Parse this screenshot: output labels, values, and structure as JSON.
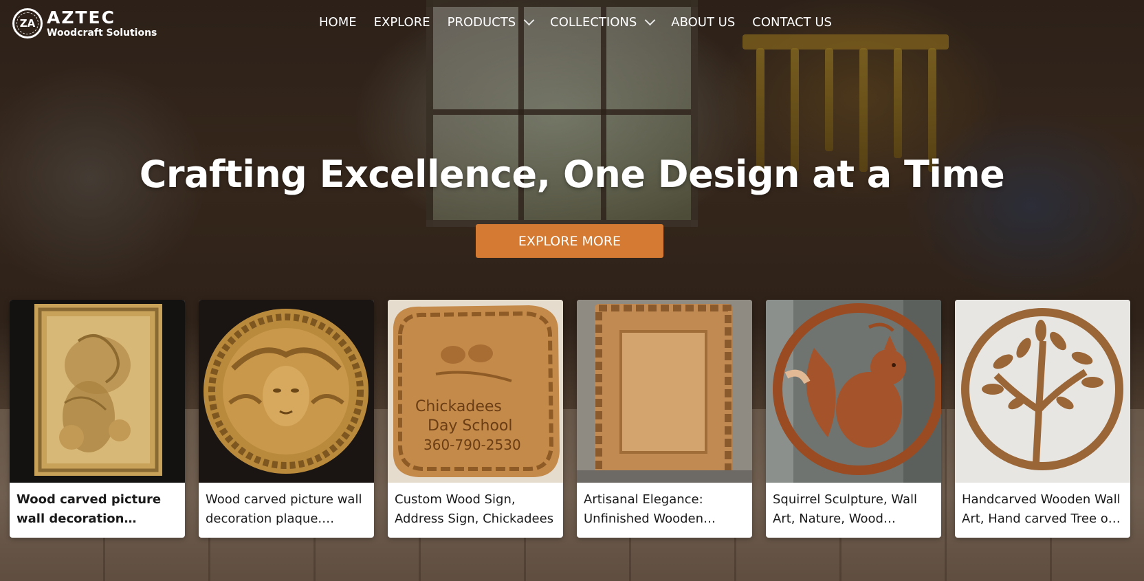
{
  "brand": {
    "name": "AZTEC",
    "tagline": "Woodcraft Solutions",
    "badge_text": "ZA",
    "icon": "aztec-logo-icon"
  },
  "nav": {
    "items": [
      {
        "label": "HOME",
        "has_dropdown": false
      },
      {
        "label": "EXPLORE",
        "has_dropdown": false
      },
      {
        "label": "PRODUCTS",
        "has_dropdown": true
      },
      {
        "label": "COLLECTIONS",
        "has_dropdown": true
      },
      {
        "label": "ABOUT US",
        "has_dropdown": false
      },
      {
        "label": "CONTACT US",
        "has_dropdown": false
      }
    ],
    "dropdown_icon": "chevron-down-icon"
  },
  "hero": {
    "title": "Crafting Excellence, One Design at a Time",
    "cta_label": "EXPLORE MORE"
  },
  "colors": {
    "accent": "#d47a32",
    "card_bg": "#ffffff",
    "text_dark": "#1a1a1a"
  },
  "products": [
    {
      "title": "Wood carved picture wall decoration plaque. Floral relief",
      "image": "carved-floral-plaque-image"
    },
    {
      "title": "Wood carved picture wall decoration plaque. Medusa relief",
      "image": "carved-medusa-medallion-image"
    },
    {
      "title": "Custom Wood Sign, Address Sign, Chickadees",
      "image": "custom-wood-sign-image",
      "sign_text": [
        "Chickadees",
        "Day School",
        "360-790-2530"
      ]
    },
    {
      "title": "Artisanal Elegance: Unfinished Wooden Frame",
      "image": "carved-wooden-frame-image"
    },
    {
      "title": "Squirrel Sculpture, Wall Art, Nature, Wood Carving",
      "image": "squirrel-sculpture-image"
    },
    {
      "title": "Handcarved Wooden Wall Art, Hand carved Tree of Life",
      "image": "tree-of-life-wall-art-image"
    }
  ]
}
